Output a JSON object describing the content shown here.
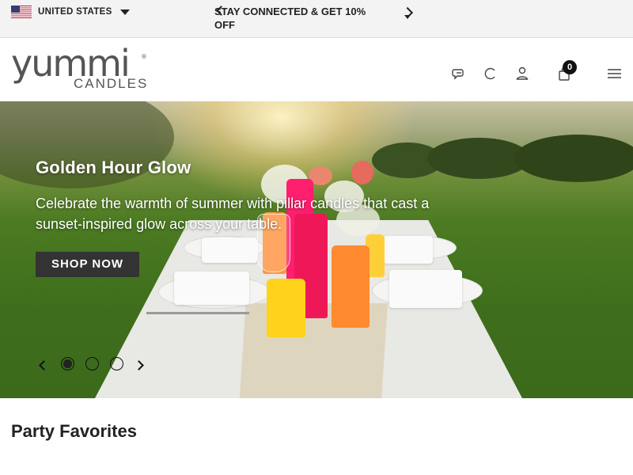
{
  "topbar": {
    "country": "UNITED STATES",
    "announcement": "STAY CONNECTED & GET 10% OFF"
  },
  "header": {
    "logo_word": "yummi",
    "logo_sub": "CANDLES",
    "logo_mark": "®",
    "cart_count": "0",
    "icons": [
      "chat-icon",
      "refresh-icon",
      "user-icon",
      "bag-icon",
      "menu-icon"
    ]
  },
  "hero": {
    "title": "Golden Hour Glow",
    "text": "Celebrate the warmth of summer with pillar candles that cast a sunset-inspired glow across your table.",
    "cta": "SHOP NOW",
    "slides_total": 3,
    "active_slide": 1
  },
  "section": {
    "title": "Party Favorites"
  },
  "colors": {
    "button": "#333333",
    "topbar_bg": "#f3f3f3",
    "text": "#222222"
  }
}
